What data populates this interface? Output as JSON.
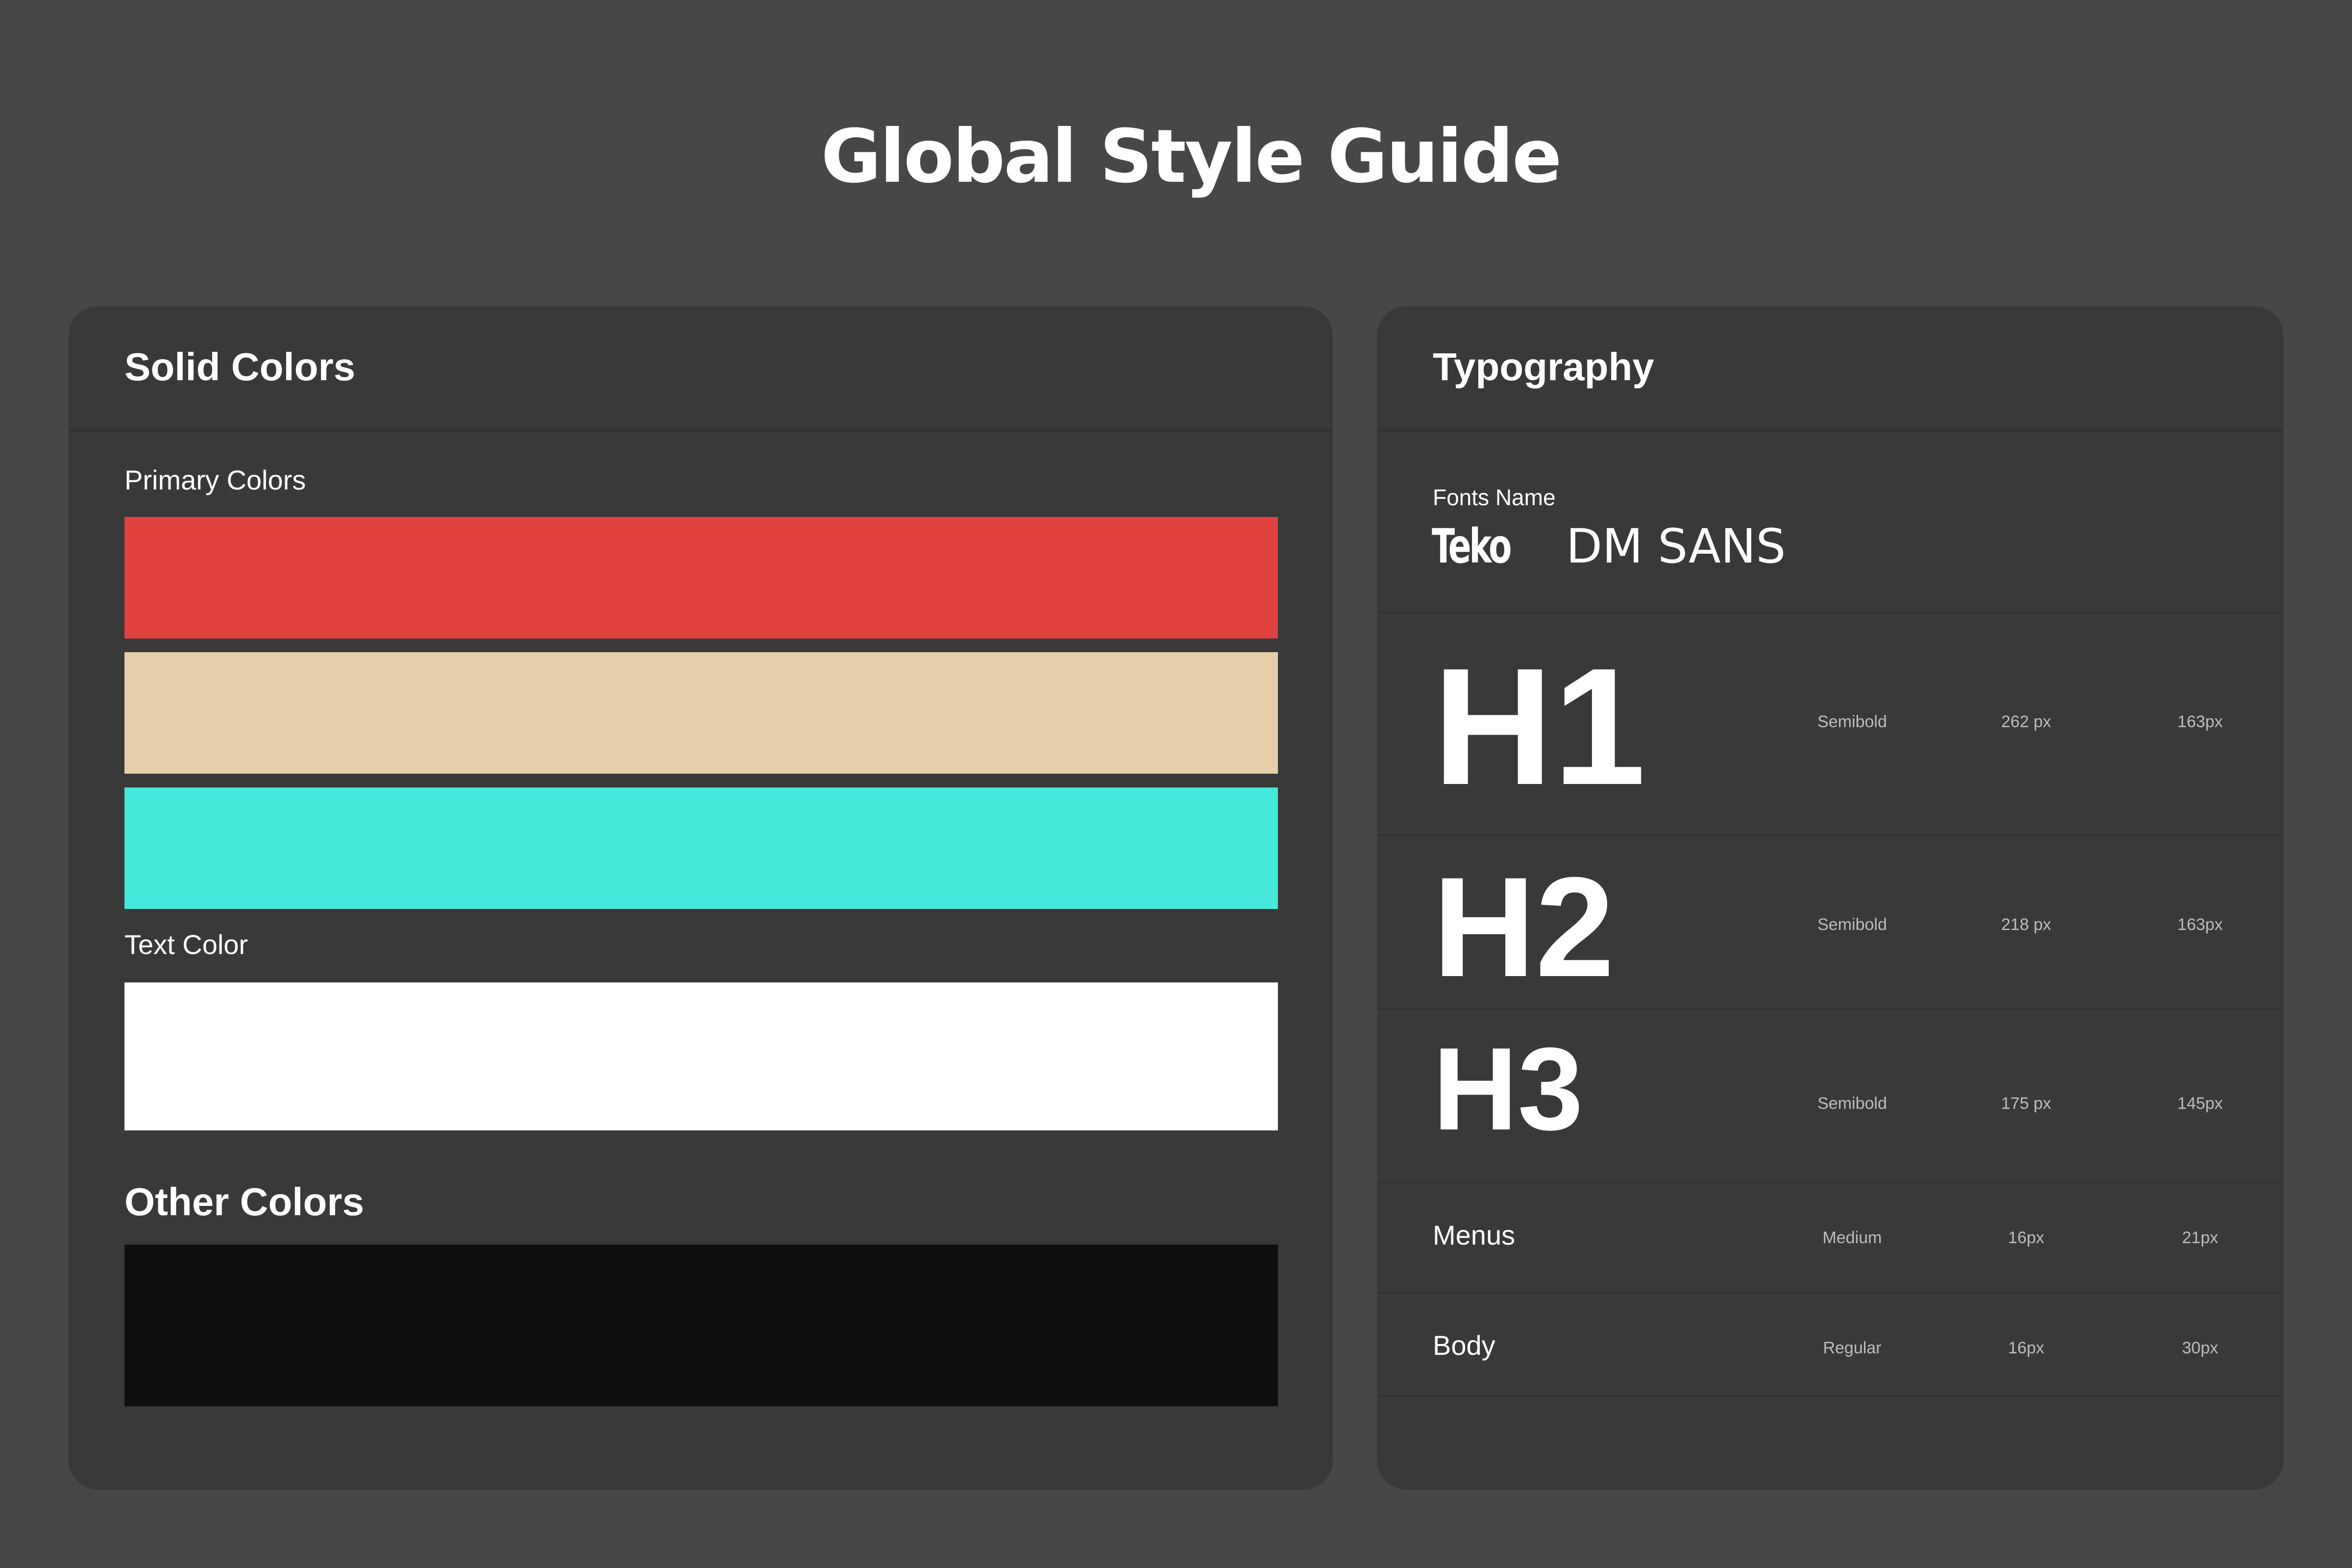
{
  "title": "Global Style Guide",
  "solid_colors": {
    "heading": "Solid Colors",
    "primary_label": "Primary Colors",
    "primary": [
      "#E1423F",
      "#E5CFA8",
      "#45E8DB"
    ],
    "text_label": "Text Color",
    "text_color": "#FFFFFF",
    "other_heading": "Other Colors",
    "other": [
      "#0F0F0F"
    ]
  },
  "typography": {
    "heading": "Typography",
    "fonts_label": "Fonts Name",
    "fonts": [
      "Teko",
      "DM SANS"
    ],
    "rows": [
      {
        "name": "H1",
        "weight": "Semibold",
        "size": "262 px",
        "line_height": "163px"
      },
      {
        "name": "H2",
        "weight": "Semibold",
        "size": "218 px",
        "line_height": "163px"
      },
      {
        "name": "H3",
        "weight": "Semibold",
        "size": "175 px",
        "line_height": "145px"
      },
      {
        "name": "Menus",
        "weight": "Medium",
        "size": "16px",
        "line_height": "21px"
      },
      {
        "name": "Body",
        "weight": "Regular",
        "size": "16px",
        "line_height": "30px"
      }
    ]
  },
  "colors": {
    "page_background": "#474747",
    "panel_background": "#393939",
    "divider": "#333333",
    "meta_text": "#BDBDBD"
  }
}
